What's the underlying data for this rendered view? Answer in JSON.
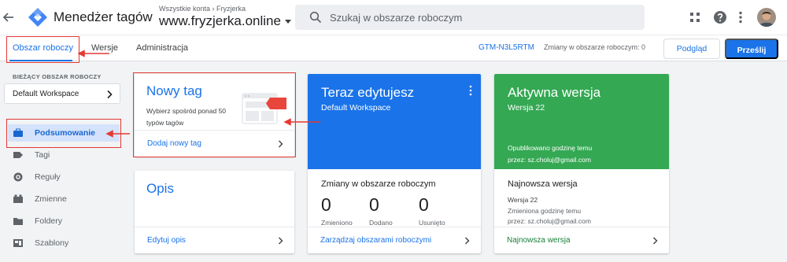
{
  "header": {
    "app_title": "Menedżer tagów",
    "breadcrumb": "Wszystkie konta › Fryzjerka",
    "container_name": "www.fryzjerka.online",
    "search_placeholder": "Szukaj w obszarze roboczym"
  },
  "tabs": [
    {
      "label": "Obszar roboczy",
      "active": true
    },
    {
      "label": "Wersje",
      "active": false
    },
    {
      "label": "Administracja",
      "active": false
    }
  ],
  "toolbar": {
    "container_id": "GTM-N3L5RTM",
    "workspace_changes": "Zmiany w obszarze roboczym: 0",
    "preview_label": "Podgląd",
    "submit_label": "Prześlij"
  },
  "sidebar": {
    "workspace_label": "BIEŻĄCY OBSZAR ROBOCZY",
    "workspace_name": "Default Workspace",
    "items": [
      {
        "label": "Podsumowanie",
        "icon": "briefcase-icon",
        "active": true
      },
      {
        "label": "Tagi",
        "icon": "tag-icon",
        "active": false
      },
      {
        "label": "Reguły",
        "icon": "trigger-icon",
        "active": false
      },
      {
        "label": "Zmienne",
        "icon": "variables-icon",
        "active": false
      },
      {
        "label": "Foldery",
        "icon": "folder-icon",
        "active": false
      },
      {
        "label": "Szablony",
        "icon": "templates-icon",
        "active": false
      }
    ]
  },
  "cards": {
    "new_tag": {
      "title": "Nowy tag",
      "description": "Wybierz spośród ponad 50 typów tagów",
      "link": "Dodaj nowy tag"
    },
    "description": {
      "title": "Opis",
      "link": "Edytuj opis"
    },
    "editing": {
      "title": "Teraz edytujesz",
      "workspace": "Default Workspace",
      "changes_title": "Zmiany w obszarze roboczym",
      "stats": [
        {
          "value": "0",
          "label": "Zmieniono"
        },
        {
          "value": "0",
          "label": "Dodano"
        },
        {
          "value": "0",
          "label": "Usunięto"
        }
      ],
      "link": "Zarządzaj obszarami roboczymi"
    },
    "live": {
      "title": "Aktywna wersja",
      "version": "Wersja 22",
      "published": "Opublikowano godzinę temu",
      "published_by": "przez: sz.choluj@gmail.com",
      "latest_title": "Najnowsza wersja",
      "latest_version": "Wersja 22",
      "latest_changed": "Zmieniona godzinę temu",
      "latest_by": "przez: sz.choluj@gmail.com",
      "link": "Najnowsza wersja"
    }
  },
  "colors": {
    "accent": "#1a73e8",
    "live_green": "#34a853",
    "annotation_red": "#e53935"
  }
}
